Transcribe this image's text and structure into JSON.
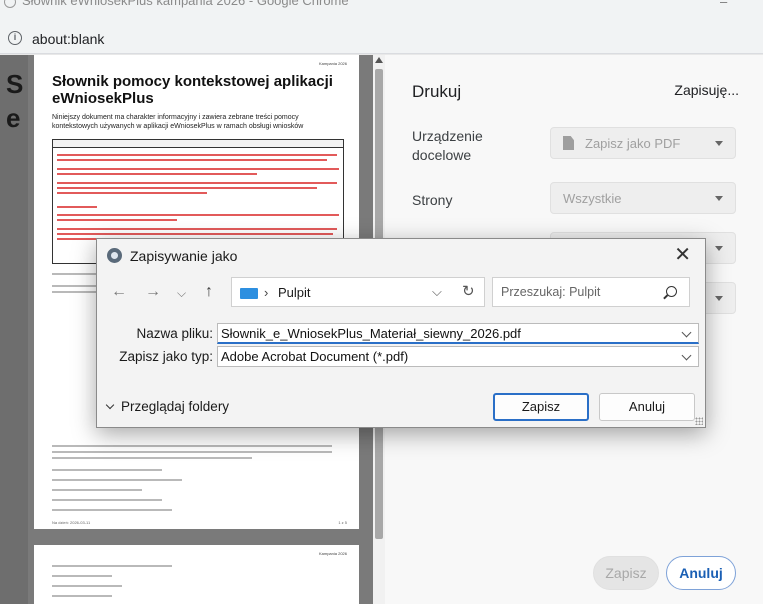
{
  "browser": {
    "window_title": "Słownik eWniosekPlus kampania 2026 - Google Chrome",
    "url": "about:blank"
  },
  "document": {
    "header_small": "Kampania 2026",
    "title": "Słownik pomocy kontekstowej aplikacji eWniosekPlus",
    "intro": "Niniejszy dokument ma charakter informacyjny i zawiera zebrane treści pomocy kontekstowych używanych w aplikacji eWniosekPlus w ramach obsługi wniosków",
    "box_title": "Materiał siewny kategorii elitarny lub materiał siewny kategorii kwalifikowany (E_MSGK)",
    "footer_left": "Na dzień: 2026-03-11",
    "footer_right": "1 z 5",
    "page2_header": "Kampania 2026"
  },
  "print_panel": {
    "title": "Drukuj",
    "status": "Zapisuję...",
    "destination_label": "Urządzenie docelowe",
    "destination_value": "Zapisz jako PDF",
    "pages_label": "Strony",
    "pages_value": "Wszystkie",
    "save_button": "Zapisz",
    "cancel_button": "Anuluj"
  },
  "save_dialog": {
    "title": "Zapisywanie jako",
    "path_location": "Pulpit",
    "search_placeholder": "Przeszukaj: Pulpit",
    "filename_label": "Nazwa pliku:",
    "filename_value": "Słownik_e_WniosekPlus_Materiał_siewny_2026.pdf",
    "filetype_label": "Zapisz jako typ:",
    "filetype_value": "Adobe Acrobat Document (*.pdf)",
    "browse_folders": "Przeglądaj foldery",
    "save_button": "Zapisz",
    "cancel_button": "Anuluj"
  }
}
